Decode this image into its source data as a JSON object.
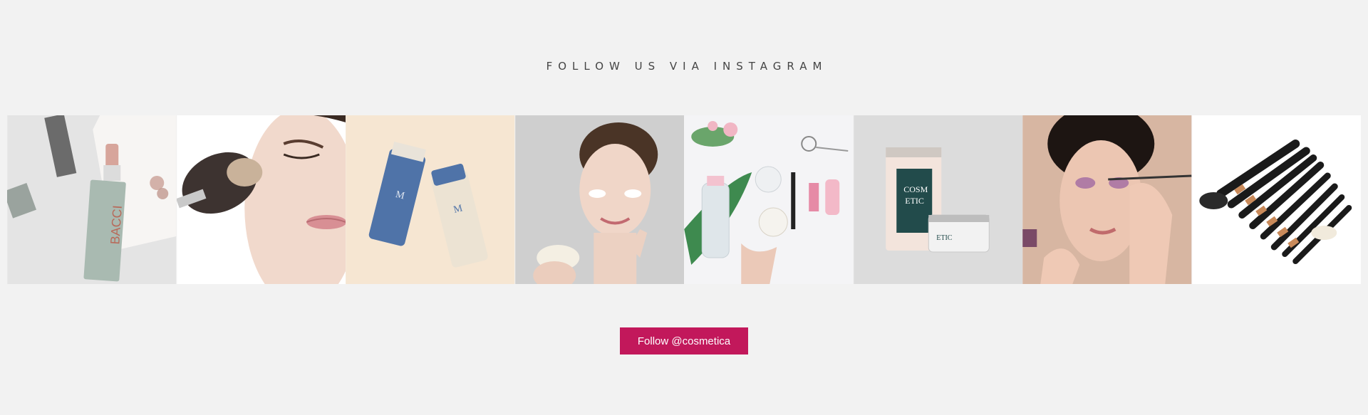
{
  "section": {
    "heading": "FOLLOW US VIA INSTAGRAM"
  },
  "gallery": {
    "tiles": [
      {
        "icon": "lipstick-photo",
        "bg": "#e6e6e6"
      },
      {
        "icon": "face-powder-brush-photo",
        "bg": "#ffffff"
      },
      {
        "icon": "cream-tubes-photo",
        "bg": "#f6e6d2"
      },
      {
        "icon": "woman-face-cream-photo",
        "bg": "#cfcfcf"
      },
      {
        "icon": "beauty-flatlay-photo",
        "bg": "#f4f4f6"
      },
      {
        "icon": "cosmetic-jars-photo",
        "bg": "#dcdcdc"
      },
      {
        "icon": "eye-makeup-photo",
        "bg": "#d9b8a4"
      },
      {
        "icon": "makeup-brushes-photo",
        "bg": "#ffffff"
      }
    ],
    "labels": {
      "lipstick": "BACCI",
      "tube": "M",
      "jar_top": "COSM",
      "jar_bottom": "ETIC",
      "small_jar": "ETIC"
    }
  },
  "cta": {
    "follow_label": "Follow @cosmetica",
    "accent": "#c2185b"
  }
}
